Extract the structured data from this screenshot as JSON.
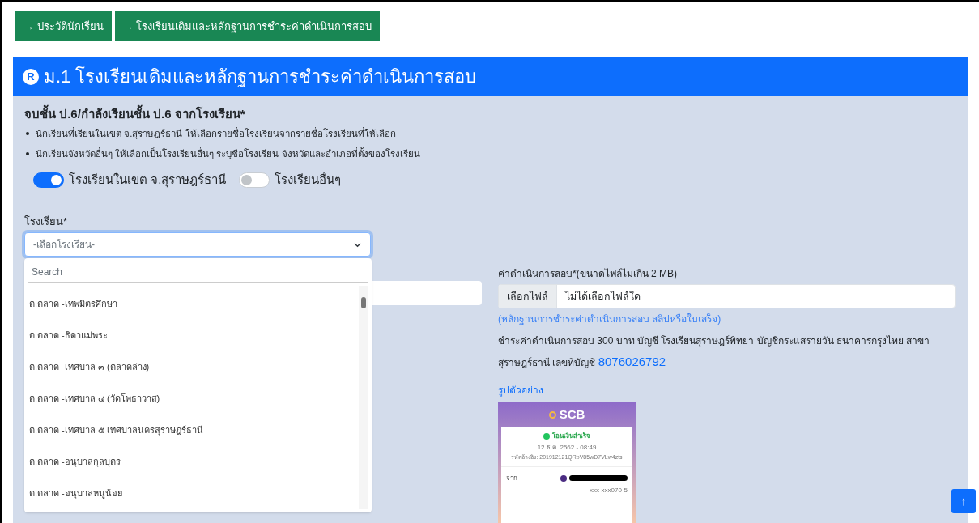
{
  "nav_buttons": [
    {
      "arrow": "→",
      "label": "ประวัตินักเรียน"
    },
    {
      "arrow": "→",
      "label": "โรงเรียนเดิมและหลักฐานการชำระค่าดำเนินการสอบ"
    }
  ],
  "header": {
    "badge": "R",
    "title": "ม.1 โรงเรียนเดิมและหลักฐานการชำระค่าดำเนินการสอบ"
  },
  "question": "จบชั้น ป.6/กำลังเรียนชั้น ป.6 จากโรงเรียน*",
  "notes": [
    "นักเรียนที่เรียนในเขต จ.สุราษฎร์ธานี ให้เลือกรายชื่อโรงเรียนจากรายชื่อโรงเรียนที่ให้เลือก",
    "นักเรียนจังหวัดอื่นๆ ให้เลือกเป็นโรงเรียนอื่นๆ ระบุชื่อโรงเรียน จังหวัดและอำเภอที่ตั้งของโรงเรียน"
  ],
  "switches": [
    {
      "label": "โรงเรียนในเขต จ.สุราษฎร์ธานี",
      "on": true
    },
    {
      "label": "โรงเรียนอื่นๆ",
      "on": false
    }
  ],
  "school_select": {
    "label": "โรงเรียน*",
    "value": "-เลือกโรงเรียน-",
    "expanded": true,
    "search_placeholder": "Search",
    "options": [
      {
        "label": "ต.ตลาด -เทพมิตรศึกษา"
      },
      {
        "label": "ต.ตลาด -ธิดาแม่พระ"
      },
      {
        "label": "ต.ตลาด -เทศบาล ๓ (ตลาดล่าง)"
      },
      {
        "label": "ต.ตลาด -เทศบาล ๔ (วัดโพธาวาส)"
      },
      {
        "label": "ต.ตลาด -เทศบาล ๕ เทศบาลนครสุราษฎร์ธานี"
      },
      {
        "label": "ต.ตลาด -อนุบาลกุลบุตร"
      },
      {
        "label": "ต.ตลาด -อนุบาลหนูน้อย"
      }
    ]
  },
  "fee_upload": {
    "label": "ค่าดำเนินการสอบ*(ขนาดไฟล์ไม่เกิน 2 MB)",
    "button": "เลือกไฟล์",
    "value": "ไม่ได้เลือกไฟล์ใด",
    "hint": "(หลักฐานการชำระค่าดำเนินการสอบ สลิปหรือใบเสร็จ)"
  },
  "payment_info": "ชำระค่าดำเนินการสอบ 300 บาท บัญชี โรงเรียนสุราษฎร์พิทยา บัญชีกระแสรายวัน ธนาคารกรุงไทย สาขา สุราษฎร์ธานี เลขที่บัญชี",
  "account_number": "8076026792",
  "sample_link": "รูปตัวอย่าง",
  "sample_slip": {
    "bank": "SCB",
    "status": "โอนเงินสำเร็จ",
    "date": "12 ธ.ค. 2562 - 08:49",
    "reference": "รหัสอ้างอิง: 201912121QRpV85wD7VLw4zts",
    "from_label": "จาก",
    "from_account": "xxx-xxx070-5"
  },
  "back_to_top": "↑"
}
